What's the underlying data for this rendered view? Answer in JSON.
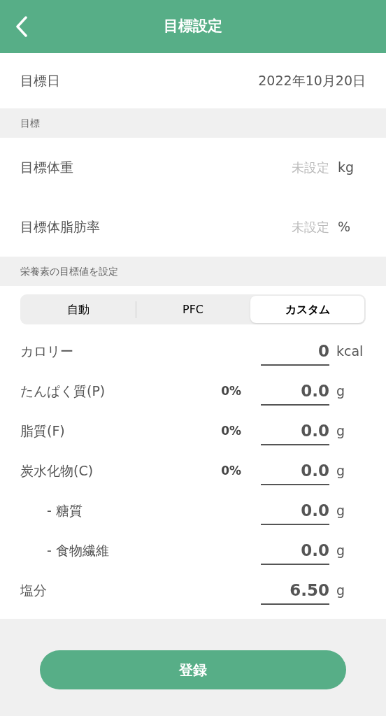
{
  "header": {
    "title": "目標設定"
  },
  "target_date": {
    "label": "目標日",
    "value": "2022年10月20日"
  },
  "goal_section": {
    "heading": "目標",
    "rows": [
      {
        "label": "目標体重",
        "value": "未設定",
        "unit": "kg"
      },
      {
        "label": "目標体脂肪率",
        "value": "未設定",
        "unit": "%"
      }
    ]
  },
  "nutrient_section": {
    "heading": "栄養素の目標値を設定",
    "modes": [
      {
        "label": "自動",
        "selected": false
      },
      {
        "label": "PFC",
        "selected": false
      },
      {
        "label": "カスタム",
        "selected": true
      }
    ],
    "rows": [
      {
        "label": "カロリー",
        "value": "0",
        "unit": "kcal"
      },
      {
        "label": "たんぱく質(P)",
        "percent": "0%",
        "value": "0.0",
        "unit": "g"
      },
      {
        "label": "脂質(F)",
        "percent": "0%",
        "value": "0.0",
        "unit": "g"
      },
      {
        "label": "炭水化物(C)",
        "percent": "0%",
        "value": "0.0",
        "unit": "g",
        "children": [
          {
            "label": "- 糖質",
            "value": "0.0",
            "unit": "g"
          },
          {
            "label": "- 食物繊維",
            "value": "0.0",
            "unit": "g"
          }
        ]
      },
      {
        "label": "塩分",
        "value": "6.50",
        "unit": "g"
      }
    ]
  },
  "register_button": "登録"
}
